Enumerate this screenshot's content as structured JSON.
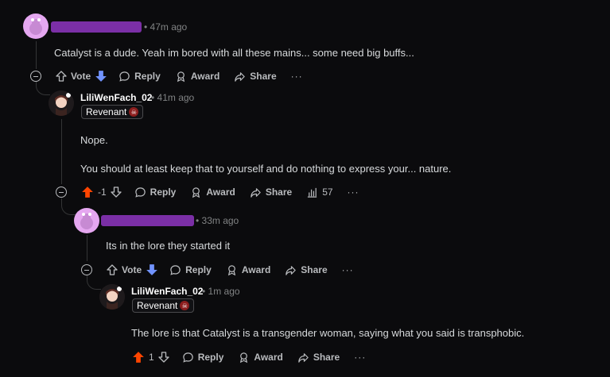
{
  "comments": [
    {
      "author": "",
      "time": "• 47m ago",
      "body": "Catalyst is a dude. Yeah im bored with all these mains... some need big buffs...",
      "actions": {
        "vote": "Vote",
        "reply": "Reply",
        "award": "Award",
        "share": "Share",
        "more": "···"
      }
    },
    {
      "author": "LiliWenFach_02",
      "time": "• 41m ago",
      "flair": "Revenant",
      "body_lines": [
        "Nope.",
        "You should at least keep that to yourself and do nothing to express your... nature."
      ],
      "actions": {
        "score": "-1",
        "reply": "Reply",
        "award": "Award",
        "share": "Share",
        "insights": "57",
        "more": "···"
      }
    },
    {
      "author": "",
      "time": "• 33m ago",
      "body": "Its in the lore they started it",
      "actions": {
        "vote": "Vote",
        "reply": "Reply",
        "award": "Award",
        "share": "Share",
        "more": "···"
      }
    },
    {
      "author": "LiliWenFach_02",
      "time": "• 1m ago",
      "flair": "Revenant",
      "body": "The lore is that Catalyst is a transgender woman, saying what you said is transphobic.",
      "actions": {
        "score": "1",
        "reply": "Reply",
        "award": "Award",
        "share": "Share",
        "more": "···"
      }
    }
  ],
  "colors": {
    "upvote": "#ff4500",
    "downvote": "#7193ff",
    "redaction": "#7b2fa6"
  }
}
